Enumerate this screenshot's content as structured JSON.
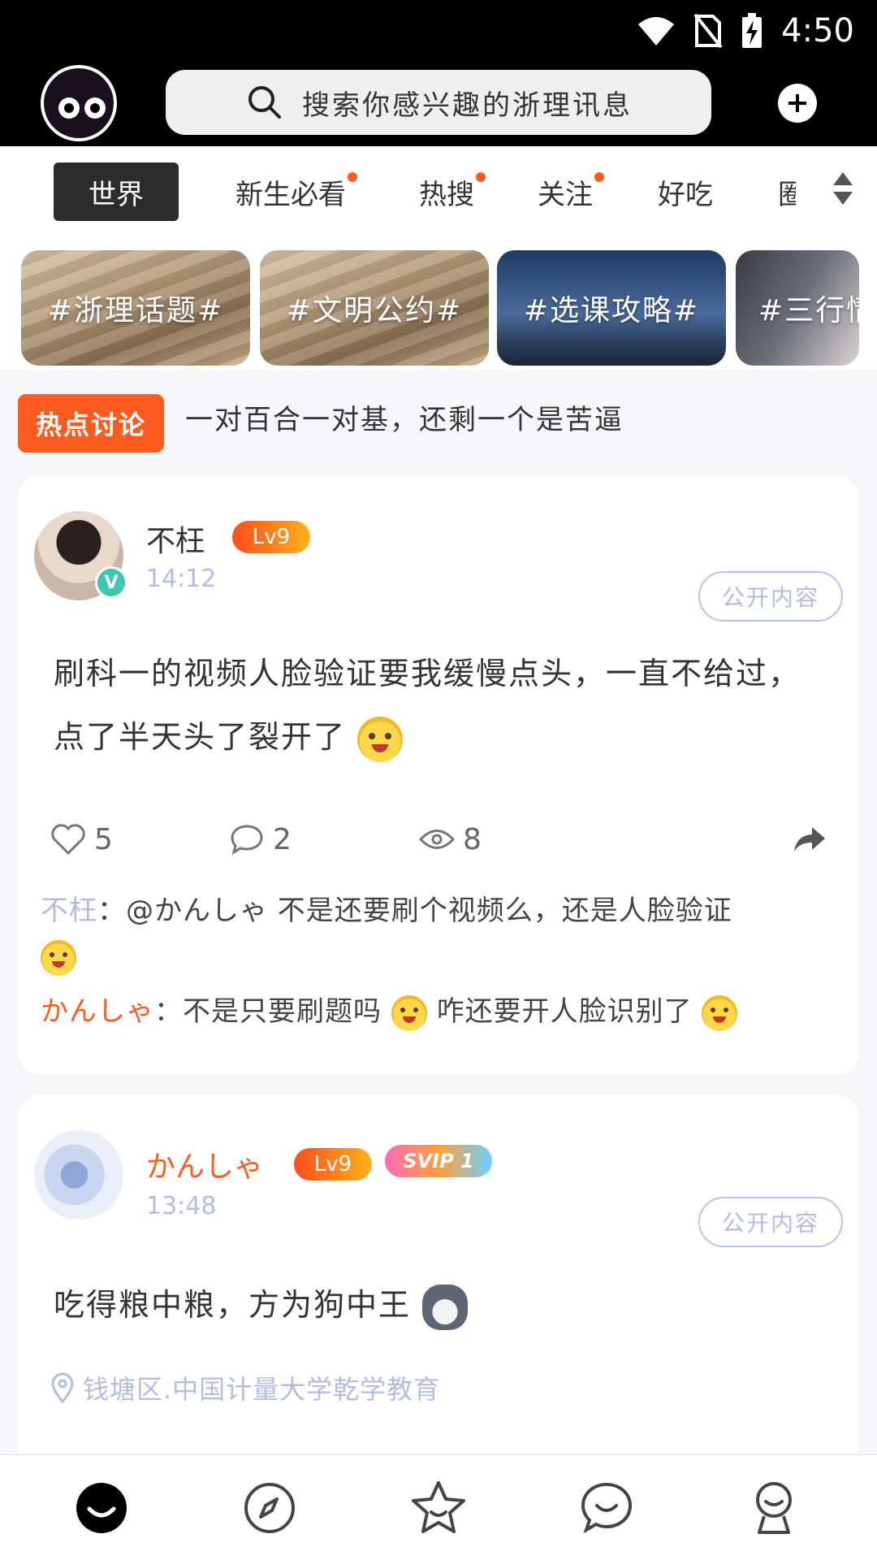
{
  "status_bar": {
    "time": "4:50"
  },
  "header": {
    "search_placeholder": "搜索你感兴趣的浙理讯息"
  },
  "tabs": [
    {
      "label": "世界",
      "active": true,
      "dot": false
    },
    {
      "label": "新生必看",
      "active": false,
      "dot": true
    },
    {
      "label": "热搜",
      "active": false,
      "dot": true
    },
    {
      "label": "关注",
      "active": false,
      "dot": true
    },
    {
      "label": "好吃",
      "active": false,
      "dot": false
    },
    {
      "label": "圈",
      "active": false,
      "dot": false
    }
  ],
  "topics": [
    {
      "label": "#浙理话题#"
    },
    {
      "label": "#文明公约#"
    },
    {
      "label": "#选课攻略#"
    },
    {
      "label": "#三行情"
    }
  ],
  "hot": {
    "badge": "热点讨论",
    "text": "一对百合一对基，还剩一个是苦逼"
  },
  "posts": [
    {
      "username": "不枉",
      "level": "Lv9",
      "verified": "V",
      "time": "14:12",
      "visibility": "公开内容",
      "content": "刷科一的视频人脸验证要我缓慢点头，一直不给过，点了半天头了裂开了",
      "likes": "5",
      "comments": "2",
      "views": "8",
      "replies": [
        {
          "name": "不枉",
          "sep": "：",
          "text": "@かんしゃ 不是还要刷个视频么，还是人脸验证"
        },
        {
          "name": "かんしゃ",
          "sep": "：",
          "text_a": "不是只要刷题吗",
          "text_b": "咋还要开人脸识别了"
        }
      ]
    },
    {
      "username": "かんしゃ",
      "level": "Lv9",
      "svip": "SVIP 1",
      "time": "13:48",
      "visibility": "公开内容",
      "content": "吃得粮中粮，方为狗中王",
      "location": "钱塘区.中国计量大学乾学教育"
    }
  ],
  "colors": {
    "accent": "#ff5a1f",
    "muted_blue": "#b2bde0",
    "active_tab_bg": "#2c2c2c"
  }
}
